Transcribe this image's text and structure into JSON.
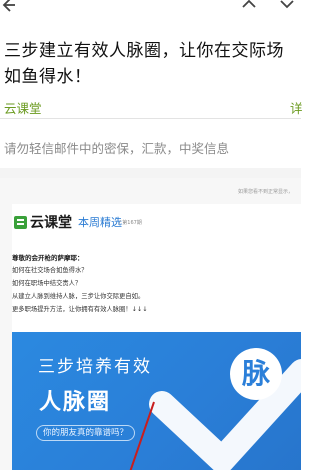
{
  "topbar": {
    "back_icon": "back-arrow-icon",
    "up_icon": "chevron-up-icon",
    "down_icon": "chevron-down-icon"
  },
  "mail": {
    "subject": "三步建立有效人脉圈，让你在交际场如鱼得水！",
    "sender": "云课堂",
    "sender_right": "详",
    "warning": "请勿轻信邮件中的密保，汇款，中奖信息"
  },
  "content": {
    "notice": "如果您看不到正常显示，",
    "brand": "云课堂",
    "weekly": "本周精选",
    "issue": "/ 第167期",
    "greeting": "尊敬的会开枪的萨摩耶：",
    "questions": [
      "如何在社交场合如鱼得水？",
      "如何在职场中结交贵人？",
      "从建立人脉到维持人脉，三步让你交际更自如。",
      "更多职场提升方法，让你拥有有效人脉圈！↓↓↓"
    ],
    "banner": {
      "line1": "三步培养有效",
      "line2": "人脉圈",
      "pill": "你的朋友真的靠谱吗？",
      "badge": "脉"
    }
  },
  "colors": {
    "sender": "#6a9a1f",
    "weekly": "#2a7bd3",
    "banner": "#2b89e0"
  }
}
